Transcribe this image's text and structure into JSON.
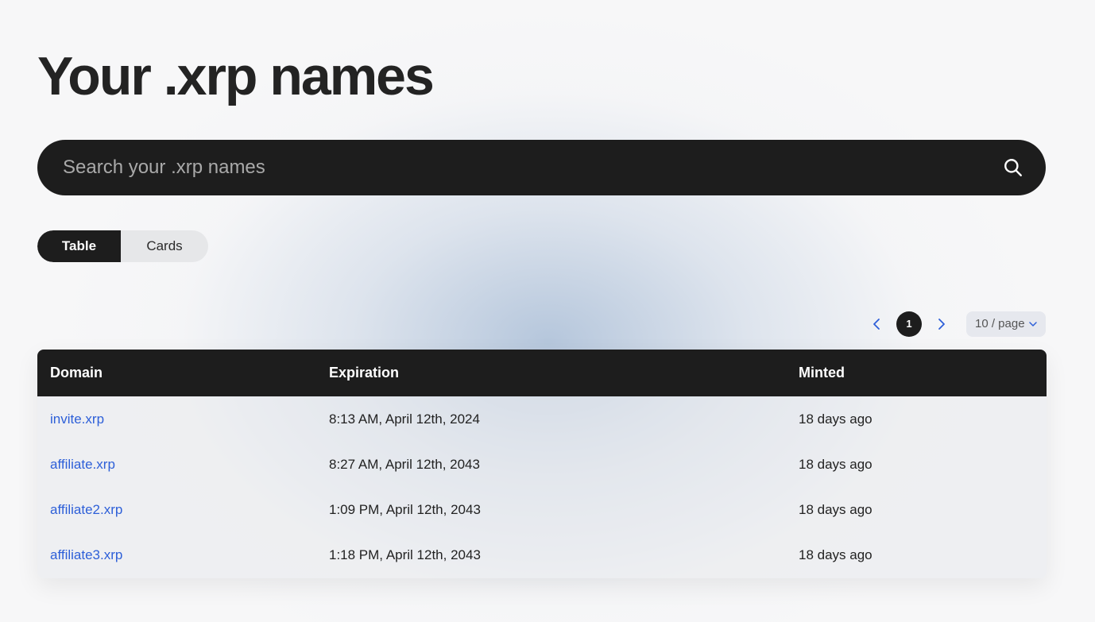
{
  "page": {
    "title": "Your .xrp names"
  },
  "search": {
    "placeholder": "Search your .xrp names",
    "icon": "search-icon"
  },
  "view_toggle": {
    "options": [
      "Table",
      "Cards"
    ],
    "selected": "Table"
  },
  "pagination": {
    "current_page": "1",
    "page_size_label": "10 / page",
    "prev_icon": "chevron-left-icon",
    "next_icon": "chevron-right-icon",
    "dropdown_icon": "chevron-down-icon"
  },
  "table": {
    "columns": [
      "Domain",
      "Expiration",
      "Minted"
    ],
    "rows": [
      {
        "domain": "invite.xrp",
        "expiration": "8:13 AM, April 12th, 2024",
        "minted": "18 days ago"
      },
      {
        "domain": "affiliate.xrp",
        "expiration": "8:27 AM, April 12th, 2043",
        "minted": "18 days ago"
      },
      {
        "domain": "affiliate2.xrp",
        "expiration": "1:09 PM, April 12th, 2043",
        "minted": "18 days ago"
      },
      {
        "domain": "affiliate3.xrp",
        "expiration": "1:18 PM, April 12th, 2043",
        "minted": "18 days ago"
      }
    ]
  },
  "colors": {
    "dark": "#1d1d1d",
    "link": "#2d5fd8",
    "pagination_arrow": "#2d5fd8"
  }
}
